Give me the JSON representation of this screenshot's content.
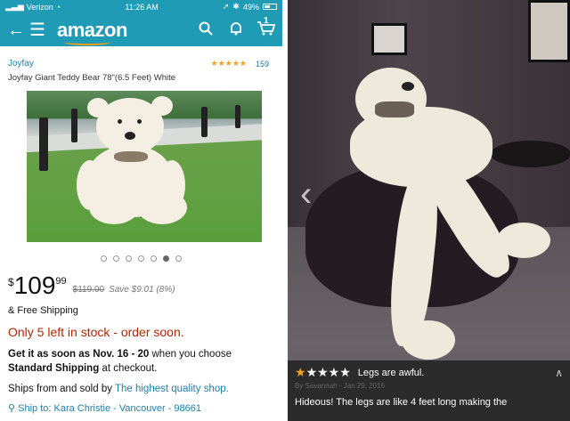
{
  "status_bar": {
    "carrier": "Verizon",
    "time": "11:26 AM",
    "battery": "49%"
  },
  "nav": {
    "logo": "amazon",
    "cart_count": "1"
  },
  "product": {
    "brand": "Joyfay",
    "rating_stars": "★★★★★",
    "rating_count": "159",
    "title": "Joyfay Giant Teddy Bear 78\"(6.5 Feet) White",
    "carousel_count": 7,
    "carousel_active": 6,
    "price_currency": "$",
    "price_whole": "109",
    "price_cents": "99",
    "price_old": "$119.00",
    "save_text": "Save $9.01 (8%)",
    "free_shipping": "& Free Shipping",
    "stock_text": "Only 5 left in stock - order soon.",
    "delivery_prefix": "Get it as soon as Nov. 16 - 20",
    "delivery_mid": " when you choose ",
    "delivery_bold2": "Standard Shipping",
    "delivery_suffix": " at checkout.",
    "sold_prefix": "Ships from and sold by ",
    "sold_link": "The highest quality shop.",
    "ship_to": "Ship to: Kara Christie - Vancouver - 98661"
  },
  "review": {
    "stars_filled": "★",
    "stars_empty": "★★★★",
    "title": "Legs are awful.",
    "byline": "By Savannah - Jan 29, 2016",
    "text": "Hideous! The legs are like 4 feet long making the"
  },
  "colors": {
    "header": "#1f9bb6",
    "link": "#1c7fa8",
    "stock": "#b12704",
    "star": "#f0a31b"
  }
}
